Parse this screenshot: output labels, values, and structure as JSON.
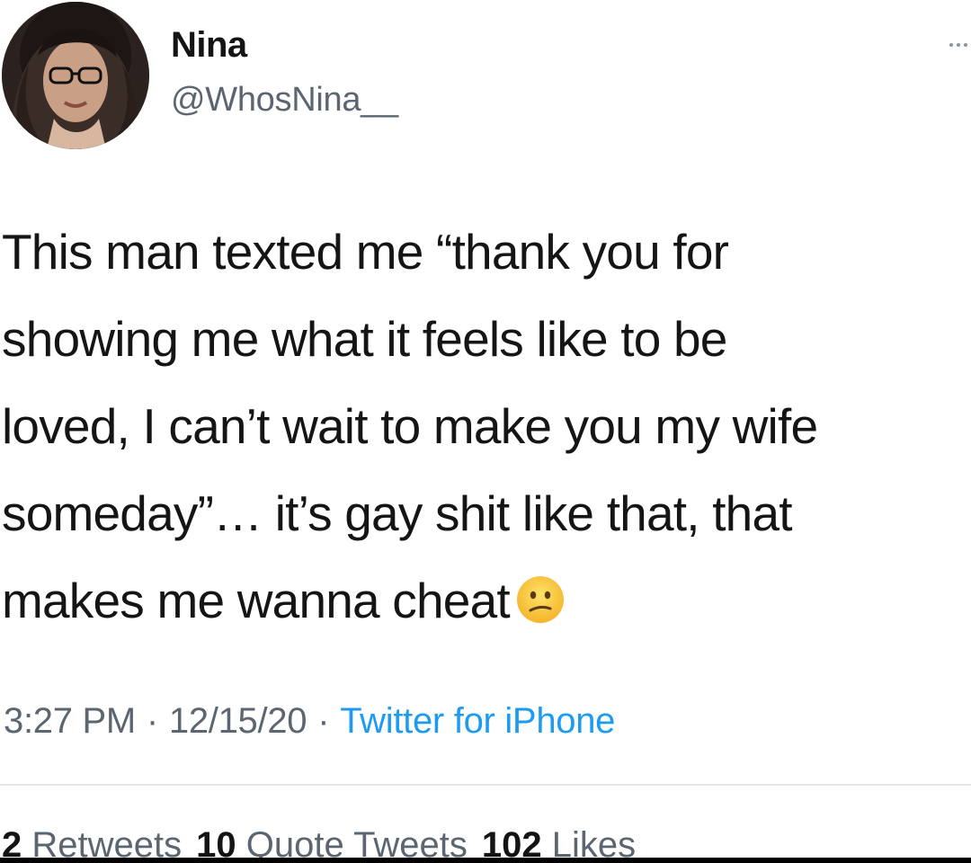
{
  "author": {
    "display_name": "Nina",
    "handle": "@WhosNina__"
  },
  "tweet": {
    "lines": [
      "This man texted me “thank you for",
      "showing me what it feels like to be",
      "loved, I can’t wait to make you my wife",
      "someday”… it’s gay shit like that, that",
      "makes me wanna cheat"
    ],
    "emoji": "confused-face"
  },
  "meta": {
    "time": "3:27 PM",
    "date": "12/15/20",
    "source": "Twitter for iPhone",
    "separator": "·"
  },
  "engagement": {
    "retweets": {
      "count": "2",
      "label": "Retweets"
    },
    "quote_tweets": {
      "count": "10",
      "label": "Quote Tweets"
    },
    "likes": {
      "count": "102",
      "label": "Likes"
    }
  },
  "colors": {
    "secondary_text": "#5b6670",
    "link": "#1d9bf0",
    "divider": "#e4e7ea"
  },
  "icons": {
    "more": "more-options-icon",
    "emoji": "confused-face-emoji-icon",
    "avatar": "avatar"
  }
}
